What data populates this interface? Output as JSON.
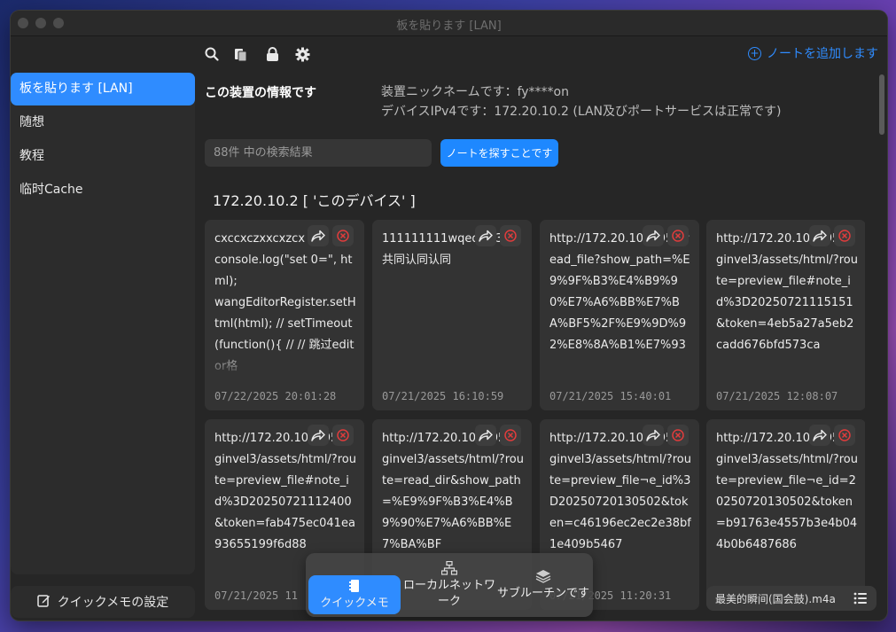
{
  "window": {
    "title": "板を貼ります [LAN]"
  },
  "toolbar": {
    "icons": [
      "search-icon",
      "clipboard-icon",
      "lock-icon",
      "gear-icon"
    ],
    "add_note_label": "ノートを追加します"
  },
  "sidebar": {
    "items": [
      {
        "label": "板を貼ります [LAN]",
        "active": true
      },
      {
        "label": "随想",
        "active": false
      },
      {
        "label": "教程",
        "active": false
      },
      {
        "label": "临时Cache",
        "active": false
      }
    ],
    "settings_label": "クイックメモの設定"
  },
  "device": {
    "title": "この装置の情報です",
    "nickname_line": "装置ニックネームです：fy****on",
    "ip_line": "デバイスIPv4です：172.20.10.2 (LAN及びポートサービスは正常です)"
  },
  "search": {
    "placeholder": "88件 中の検索結果",
    "button_label": "ノートを探すことです"
  },
  "device_header": "172.20.10.2 [ 'このデバイス' ]",
  "notes": [
    {
      "content": "cxccxczxxcxzcx\nconsole.log(\"set 0=\", html);\nwangEditorRegister.setHtml(html); // setTimeout(function(){ // // 跳过editor格",
      "date": "07/22/2025 20:01:28"
    },
    {
      "content": "111111111wqeqew3\n共同认同认同",
      "date": "07/21/2025 16:10:59"
    },
    {
      "content": "http://172.20.10.2:950/read_file?show_path=%E9%9F%B3%E4%B9%90%E7%A6%BB%E7%BA%BF5%2F%E9%9D%92%E8%8A%B1%E7%93",
      "date": "07/21/2025 15:40:01"
    },
    {
      "content": "http://172.20.10.2:950/ginvel3/assets/html/?route=preview_file#note_id%3D20250721115151&token=4eb5a27a5eb2cadd676bfd573ca",
      "date": "07/21/2025 12:08:07"
    },
    {
      "content": "http://172.20.10.2:950/ginvel3/assets/html/?route=preview_file#note_id%3D20250721112400&token=fab475ec041ea93655199f6d88",
      "date": "07/21/2025 11"
    },
    {
      "content": "http://172.20.10.2:950/ginvel3/assets/html/?route=read_dir&show_path=%E9%9F%B3%E4%B9%90%E7%A6%BB%E7%BA%BF",
      "date": ""
    },
    {
      "content": "http://172.20.10.2:950/ginvel3/assets/html/?route=preview_file¬e_id%3D20250720130502&token=c46196ec2ec2e38bf1e409b5467",
      "date": "07/21/2025 11:20:31"
    },
    {
      "content": "http://172.20.10.2:950/ginvel3/assets/html/?route=preview_file¬e_id=20250720130502&token=b91763e4557b3e4b044b0b6487686",
      "date": ""
    }
  ],
  "bottom_nav": {
    "tabs": [
      {
        "label": "クイックメモ",
        "icon": "notes-icon",
        "active": true
      },
      {
        "label": "ローカルネットワーク",
        "icon": "network-icon",
        "active": false
      },
      {
        "label": "サブルーチンです",
        "icon": "layers-icon",
        "active": false
      }
    ]
  },
  "audio": {
    "track": "最美的瞬间(国会鼓).m4a"
  },
  "colors": {
    "accent": "#2f8cff",
    "background": "#262626",
    "card": "#333333",
    "delete": "#e03c3c"
  }
}
